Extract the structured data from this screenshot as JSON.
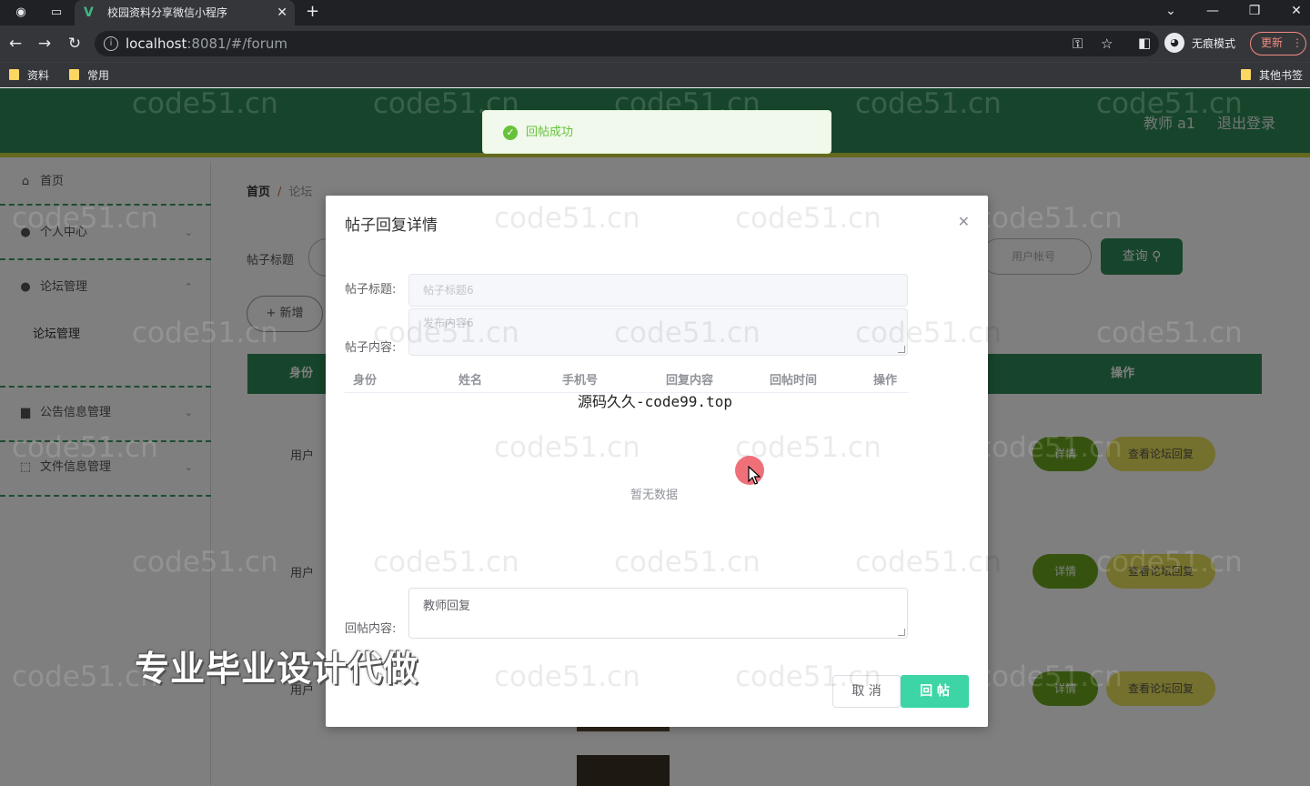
{
  "browser": {
    "tab_title": "校园资料分享微信小程序",
    "url_host": "localhost",
    "url_rest": ":8081/#/forum",
    "profile_label": "无痕模式",
    "update_label": "更新",
    "bookmarks": [
      "资料",
      "常用"
    ],
    "other_bookmarks": "其他书签"
  },
  "header": {
    "user_label": "教师 a1",
    "logout_label": "退出登录"
  },
  "sidebar": {
    "items": [
      {
        "label": "首页",
        "icon": "home-icon"
      },
      {
        "label": "个人中心",
        "icon": "user-icon"
      },
      {
        "label": "论坛管理",
        "icon": "user-icon"
      },
      {
        "label": "论坛管理",
        "icon": ""
      },
      {
        "label": "公告信息管理",
        "icon": "briefcase-icon"
      },
      {
        "label": "文件信息管理",
        "icon": "file-icon"
      }
    ]
  },
  "main": {
    "breadcrumb_home": "首页",
    "breadcrumb_sep": "/",
    "breadcrumb_current": "论坛",
    "filter_title_label": "帖子标题",
    "filter_user_placeholder": "用户帐号",
    "query_label": "查询",
    "add_label": "+ 新增",
    "table_headers": {
      "identity": "身份",
      "actions": "操作"
    },
    "rows": [
      {
        "identity": "用户",
        "detail_label": "详情",
        "view_label": "查看论坛回复"
      },
      {
        "identity": "用户",
        "detail_label": "详情",
        "view_label": "查看论坛回复"
      },
      {
        "identity": "用户",
        "detail_label": "详情",
        "view_label": "查看论坛回复"
      }
    ]
  },
  "toast": {
    "message": "回帖成功"
  },
  "dialog": {
    "title": "帖子回复详情",
    "post_title_label": "帖子标题:",
    "post_title_value": "帖子标题6",
    "post_content_label": "帖子内容:",
    "post_content_value": "发布内容6",
    "table_headers": [
      "身份",
      "姓名",
      "手机号",
      "回复内容",
      "回帖时间",
      "操作"
    ],
    "promo_text": "源码久久-code99.top",
    "empty_text": "暂无数据",
    "reply_label": "回帖内容:",
    "reply_value": "教师回复",
    "cancel_label": "取 消",
    "submit_label": "回 帖"
  },
  "watermark": "code51.cn",
  "promo_banner": "专业毕业设计代做",
  "colors": {
    "header": "#2e8b57",
    "accent_bar": "#c8d23a",
    "submit": "#3dd5a5",
    "toast_text": "#67c23a"
  }
}
